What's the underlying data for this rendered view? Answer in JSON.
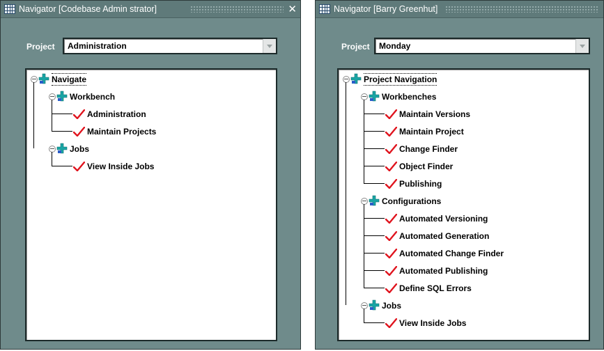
{
  "windows": [
    {
      "title": "Navigator [Codebase Admin strator]",
      "project_label": "Project",
      "project_value": "Administration",
      "tree": {
        "root": "Navigate",
        "groups": [
          {
            "label": "Workbench",
            "items": [
              "Administration",
              "Maintain Projects"
            ]
          },
          {
            "label": "Jobs",
            "items": [
              "View Inside Jobs"
            ]
          }
        ]
      }
    },
    {
      "title": "Navigator [Barry Greenhut]",
      "project_label": "Project",
      "project_value": "Monday",
      "tree": {
        "root": "Project Navigation",
        "groups": [
          {
            "label": "Workbenches",
            "items": [
              "Maintain Versions",
              "Maintain Project",
              "Change Finder",
              "Object Finder",
              "Publishing"
            ]
          },
          {
            "label": "Configurations",
            "items": [
              "Automated Versioning",
              "Automated Generation",
              "Automated Change Finder",
              "Automated Publishing",
              "Define SQL Errors"
            ]
          },
          {
            "label": "Jobs",
            "items": [
              "View Inside Jobs"
            ]
          }
        ]
      }
    }
  ],
  "icons": {
    "window": "grid-app-icon",
    "close": "close-icon",
    "dropdown": "chevron-down-icon",
    "collapse": "collapse-toggle-icon",
    "folder": "teal-plus-icon",
    "leaf": "red-check-icon"
  },
  "colors": {
    "window_bg": "#6f8b8b",
    "plus_icon": "#1aa5a5",
    "check_icon": "#e0141e"
  }
}
